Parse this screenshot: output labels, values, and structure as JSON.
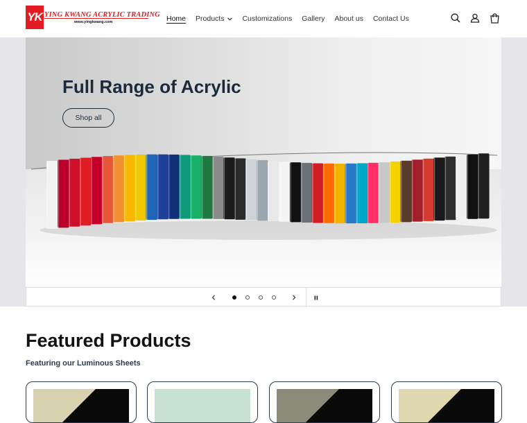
{
  "brand": {
    "mark": "YK",
    "name": "YING KWANG ACRYLIC TRADING",
    "url": "www.yingkwang.com",
    "accent": "#e31b23"
  },
  "nav": {
    "items": [
      {
        "label": "Home",
        "active": true
      },
      {
        "label": "Products",
        "has_dropdown": true
      },
      {
        "label": "Customizations"
      },
      {
        "label": "Gallery"
      },
      {
        "label": "About us"
      },
      {
        "label": "Contact Us"
      }
    ]
  },
  "header_icons": [
    "search-icon",
    "account-icon",
    "cart-icon"
  ],
  "hero": {
    "title": "Full Range of Acrylic",
    "button": "Shop all",
    "slides": 4,
    "active_slide": 1,
    "prev_icon": "chevron-left-icon",
    "next_icon": "chevron-right-icon",
    "pause_icon": "pause-icon",
    "swatch_colors": [
      "#f2f2f2",
      "#b8002a",
      "#d0102a",
      "#e01c25",
      "#c4002a",
      "#e8563a",
      "#f09030",
      "#f6b800",
      "#f0c800",
      "#1f66b8",
      "#1e3f9a",
      "#12307a",
      "#0f9a7a",
      "#18b068",
      "#1e7a40",
      "#8a8a8a",
      "#1b1b1b",
      "#2a2a2a",
      "#cfd3d8",
      "#9aa7b0",
      "#e8e8e8",
      "#f4f4f4",
      "#111111",
      "#6a7078",
      "#d01d26",
      "#ff6a00",
      "#f2b200",
      "#2a78c8",
      "#00a8c8",
      "#ff2e66",
      "#c8c8c8",
      "#f6d100",
      "#5a3a2a",
      "#a41d2b",
      "#d43a2e",
      "#1a1a1a",
      "#2e2e2e",
      "#f0f0f0",
      "#101010",
      "#202020"
    ]
  },
  "featured": {
    "title": "Featured Products",
    "subtitle": "Featuring our Luminous Sheets",
    "cards": [
      {
        "left_color": "#d8d2b0",
        "right_color": "#0a0a0a"
      },
      {
        "left_color": "#c8e2d2",
        "right_color": "#c8e2d2"
      },
      {
        "left_color": "#8c8a78",
        "right_color": "#0a0a0a"
      },
      {
        "left_color": "#e0d8b0",
        "right_color": "#0a0a0a"
      }
    ]
  }
}
